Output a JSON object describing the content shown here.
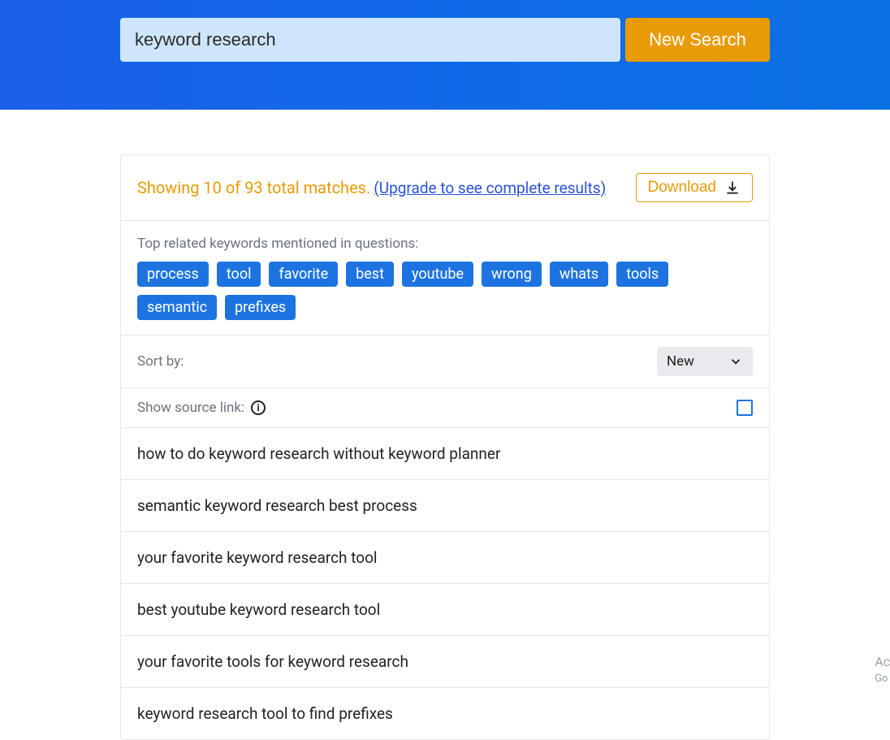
{
  "search": {
    "query": "keyword research",
    "button_label": "New Search"
  },
  "summary": {
    "showing_text": "Showing 10 of 93 total matches.",
    "upgrade_text": "(Upgrade to see complete results)",
    "download_label": "Download"
  },
  "related": {
    "heading": "Top related keywords mentioned in questions:",
    "tags": [
      "process",
      "tool",
      "favorite",
      "best",
      "youtube",
      "wrong",
      "whats",
      "tools",
      "semantic",
      "prefixes"
    ]
  },
  "sort": {
    "label": "Sort by:",
    "selected": "New"
  },
  "source_link": {
    "label": "Show source link:",
    "checked": false
  },
  "results": [
    "how to do keyword research without keyword planner",
    "semantic keyword research best process",
    "your favorite keyword research tool",
    "best youtube keyword research tool",
    "your favorite tools for keyword research",
    "keyword research tool to find prefixes"
  ],
  "watermark": {
    "line1": "Ac",
    "line2": "Go"
  }
}
